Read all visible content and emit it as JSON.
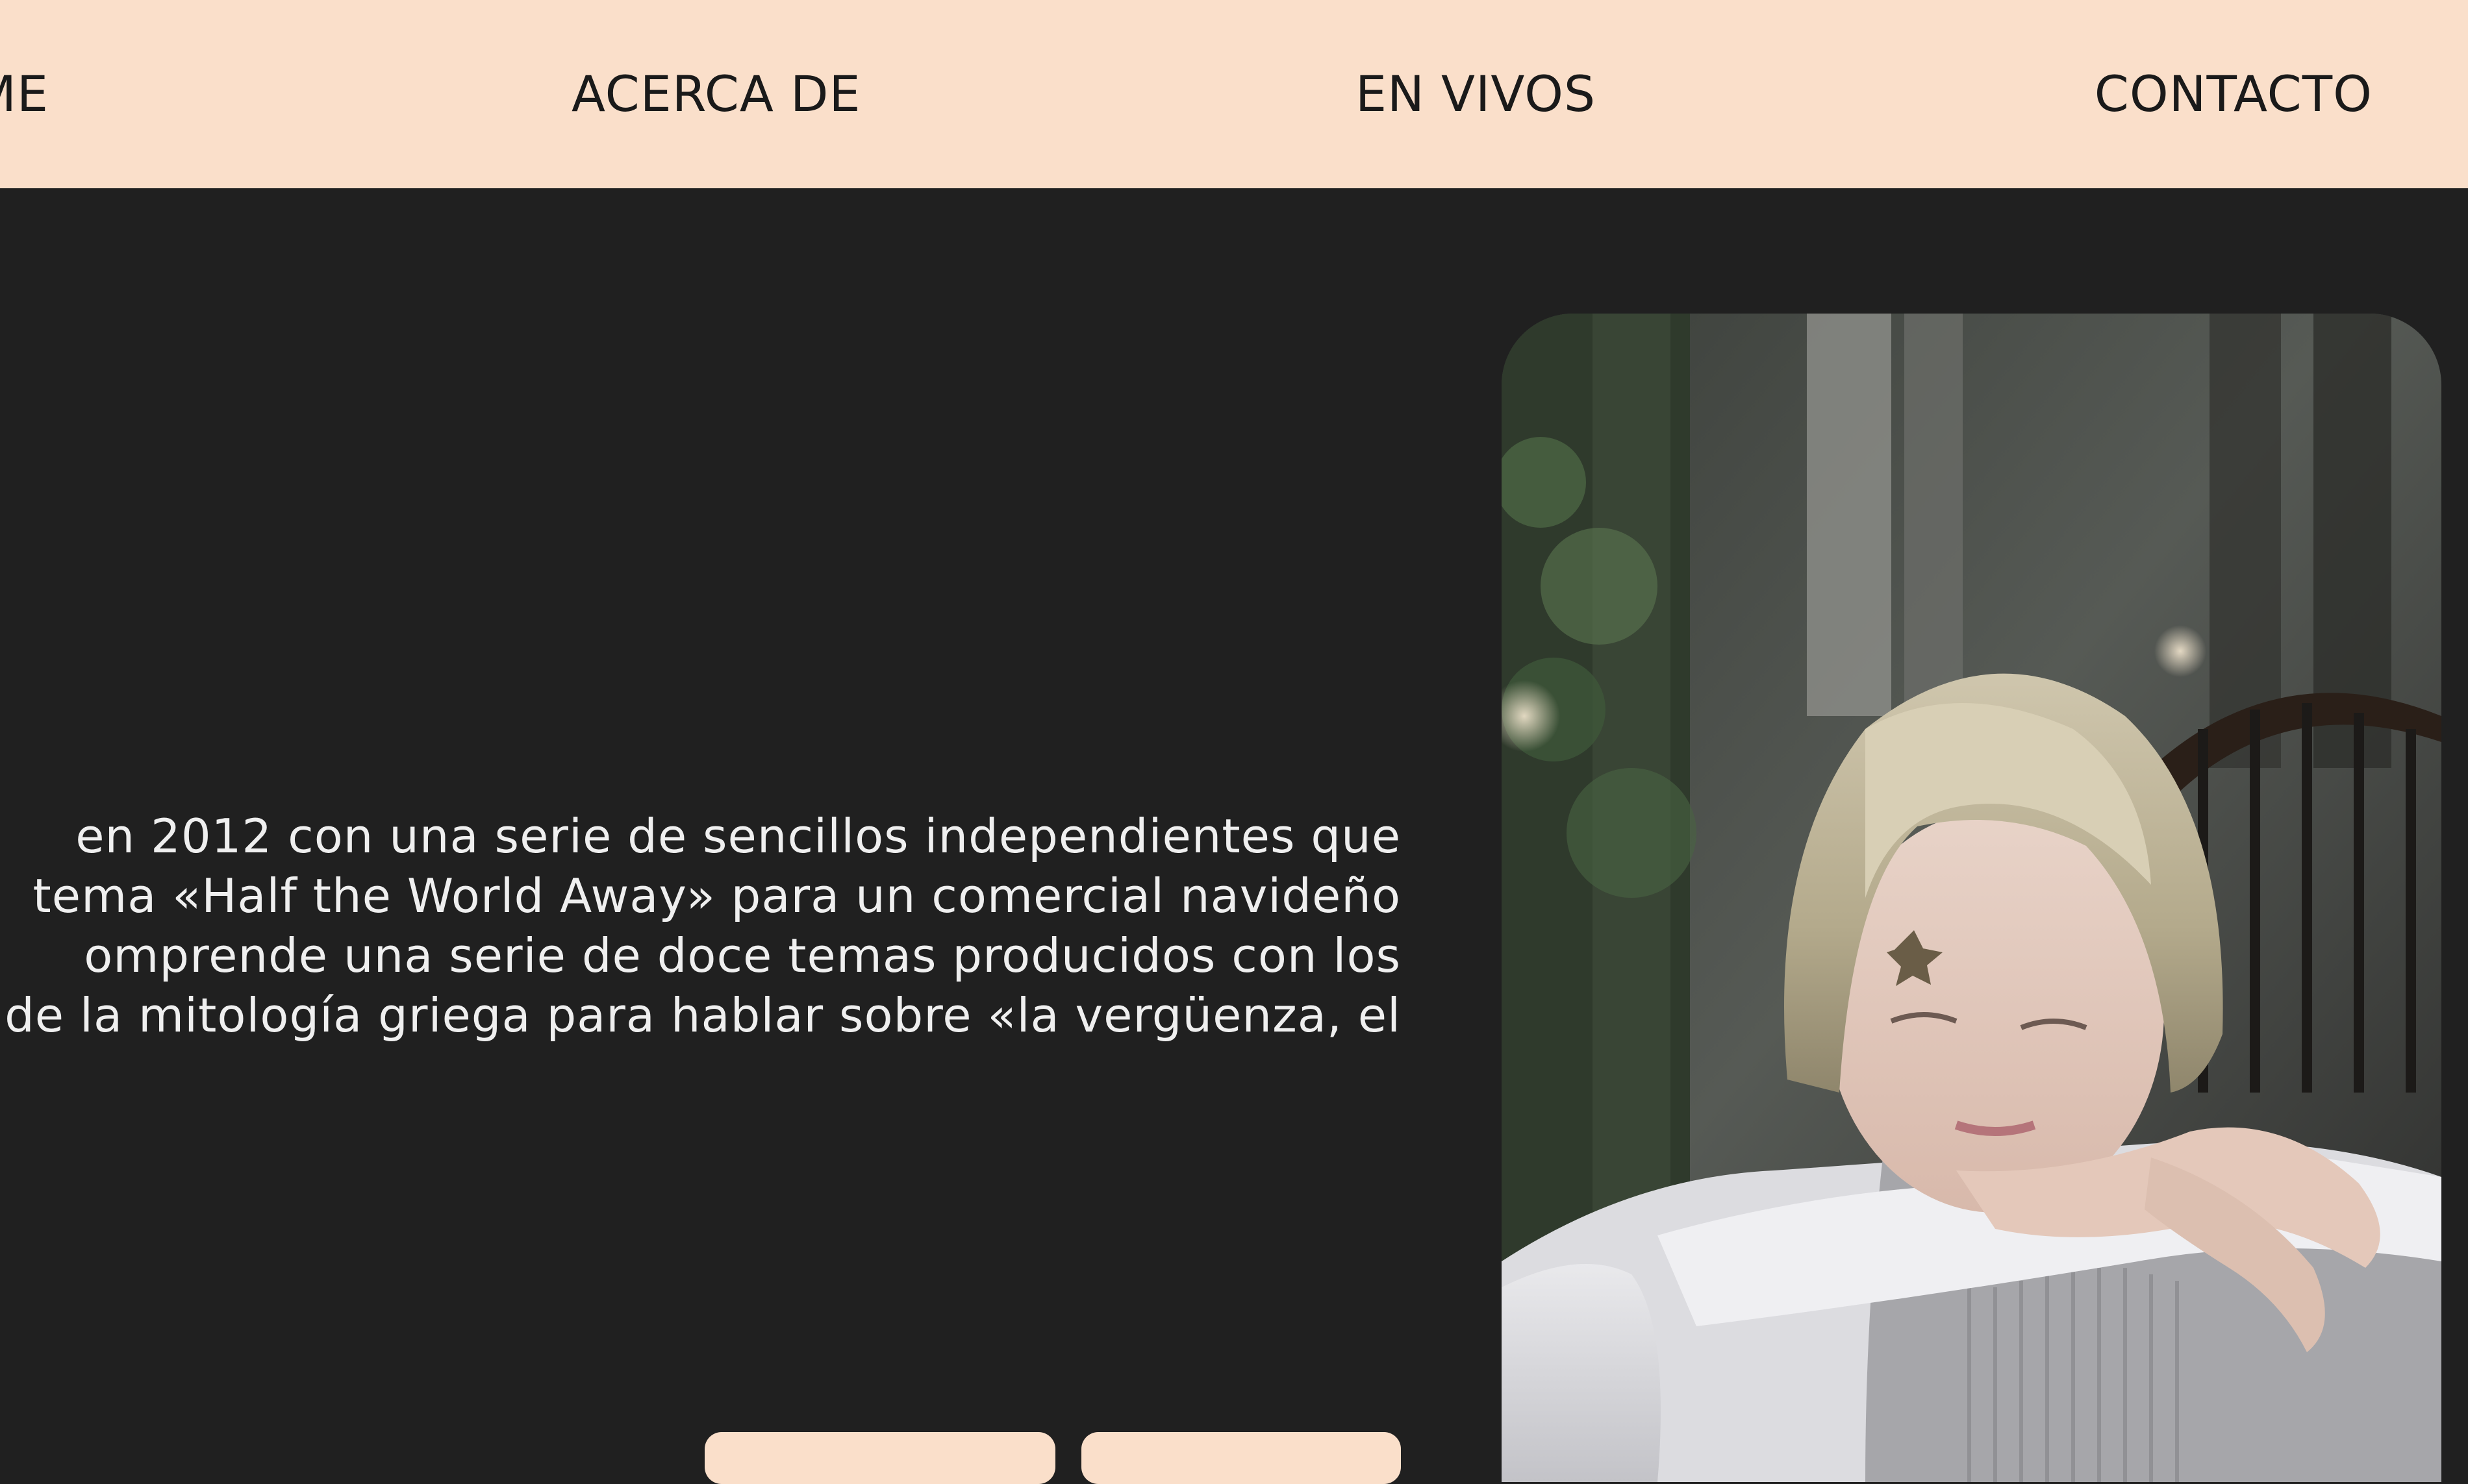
{
  "nav": {
    "items": [
      {
        "label": "HOME"
      },
      {
        "label": "ACERCA DE"
      },
      {
        "label": "EN VIVOS"
      },
      {
        "label": "CONTACTO"
      }
    ]
  },
  "hero": {
    "bio_lines": [
      "en 2012 con una serie de sencillos independientes que",
      "tema «Half the World Away» para un comercial navideño",
      "omprende una serie de doce temas producidos con los",
      "de la mitología griega para hablar sobre «la vergüenza, el"
    ],
    "buttons": [
      {
        "label": ""
      },
      {
        "label": ""
      }
    ]
  },
  "colors": {
    "background": "#202020",
    "nav_background": "#fadfca",
    "text_light": "#efefef",
    "text_dark": "#1a1a1a",
    "button": "#fadfca"
  }
}
